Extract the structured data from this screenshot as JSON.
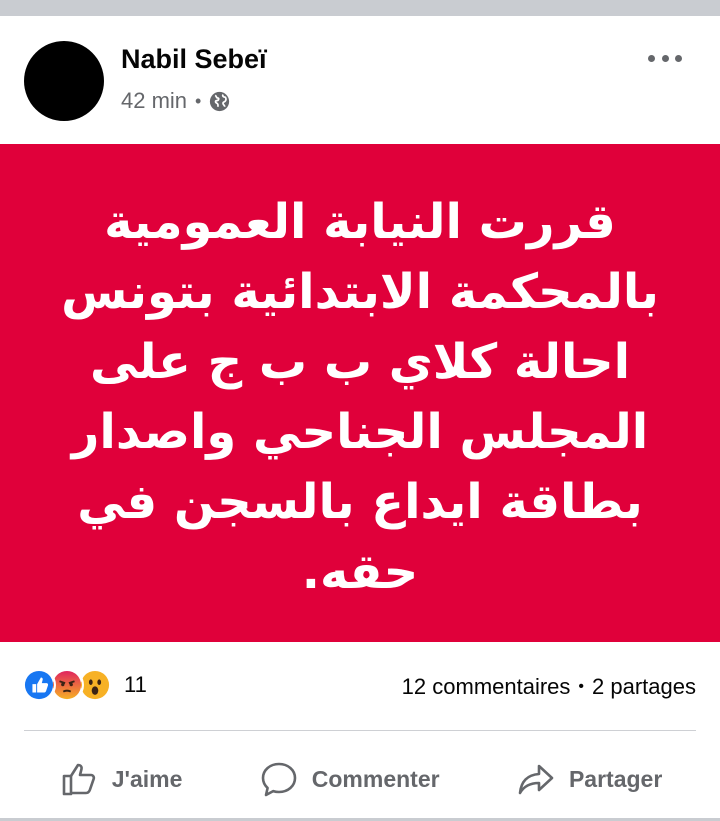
{
  "post": {
    "author": "Nabil Sebeï",
    "time": "42 min",
    "separator": "•",
    "privacy_icon": "globe-icon",
    "more_icon": "more-options-icon"
  },
  "banner": {
    "background": "#e0003a",
    "text_color": "#ffffff",
    "lines": [
      "قررت النيابة العمومية",
      "بالمحكمة الابتدائية بتونس",
      "احالة كلاي ب ب ج على",
      "المجلس الجناحي واصدار",
      "بطاقة ايداع بالسجن في حقه."
    ]
  },
  "stats": {
    "reactions": [
      "like-icon",
      "angry-icon",
      "wow-icon"
    ],
    "reaction_count": "11",
    "comments": "12 commentaires",
    "separator": "•",
    "shares": "2 partages"
  },
  "actions": {
    "like": "J'aime",
    "comment": "Commenter",
    "share": "Partager"
  },
  "colors": {
    "like_blue": "#1877f2",
    "reaction_yellow": "#f7b125",
    "angry_orange": "#e9710f",
    "muted_text": "#65676b"
  }
}
